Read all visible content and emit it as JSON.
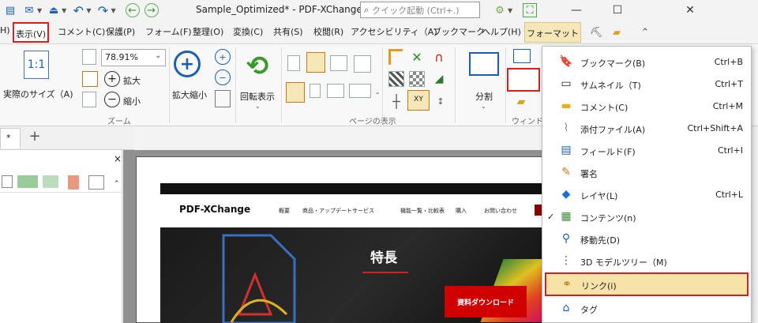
{
  "titlebar": {
    "document_title": "Sample_Optimized* - PDF-XChange Ed...",
    "quick_launch_placeholder": "クイック起動 (Ctrl+.)",
    "minimize": "—",
    "maximize": "☐",
    "close": "✕"
  },
  "menubar": {
    "items": [
      "H)",
      "表示(V)",
      "コメント(C)",
      "保護(P)",
      "フォーム(F)",
      "整理(O)",
      "変換(C)",
      "共有(S)",
      "校閲(R)",
      "アクセシビリティ（A)",
      "ブックマーク",
      "ヘルプ(H)"
    ],
    "active": "表示(V)",
    "format_tab": "フォーマット"
  },
  "ribbon": {
    "actual_size": "実際のサイズ（A)",
    "zoom_value": "78.91%",
    "zoom_in": "拡大",
    "zoom_out": "縮小",
    "magnify": "拡大縮小",
    "group_zoom": "ズーム",
    "rotate": "回転表示",
    "group_page_display": "ページの表示",
    "split": "分割",
    "group_window": "ウィンドウ"
  },
  "document_tabs": {
    "tab_symbol": "*",
    "close_symbol": "×",
    "add_symbol": "+"
  },
  "pdf_page": {
    "logo": "PDF-XChange",
    "nav": [
      "概要",
      "商品・アップデートサービス",
      "機能一覧・比較表",
      "購入",
      "お問い合わせ"
    ],
    "hero_title": "特長",
    "download_button": "資料ダウンロード"
  },
  "dropdown": {
    "items": [
      {
        "label": "ブックマーク(B)",
        "shortcut": "Ctrl+B",
        "icon": "bookmark-icon",
        "checked": false
      },
      {
        "label": "サムネイル（T)",
        "shortcut": "Ctrl+T",
        "icon": "thumbnail-icon",
        "checked": false
      },
      {
        "label": "コメント(C)",
        "shortcut": "Ctrl+M",
        "icon": "comment-icon",
        "checked": false
      },
      {
        "label": "添付ファイル(A)",
        "shortcut": "Ctrl+Shift+A",
        "icon": "attachment-icon",
        "checked": false
      },
      {
        "label": "フィールド(F)",
        "shortcut": "Ctrl+I",
        "icon": "field-icon",
        "checked": false
      },
      {
        "label": "署名",
        "shortcut": "",
        "icon": "signature-icon",
        "checked": false
      },
      {
        "label": "レイヤ(L)",
        "shortcut": "Ctrl+L",
        "icon": "layer-icon",
        "checked": false
      },
      {
        "label": "コンテンツ(n)",
        "shortcut": "",
        "icon": "content-icon",
        "checked": true
      },
      {
        "label": "移動先(D)",
        "shortcut": "",
        "icon": "destination-icon",
        "checked": false
      },
      {
        "label": "3D モデルツリー（M)",
        "shortcut": "",
        "icon": "model-tree-icon",
        "checked": false
      },
      {
        "label": "リンク(i)",
        "shortcut": "",
        "icon": "link-icon",
        "checked": false,
        "highlighted": true
      },
      {
        "label": "タグ",
        "shortcut": "",
        "icon": "tag-icon",
        "checked": false
      }
    ]
  },
  "colors": {
    "accent_red": "#d32020",
    "highlight": "#f7e3a8",
    "format_tab": "#f6e7b9"
  }
}
